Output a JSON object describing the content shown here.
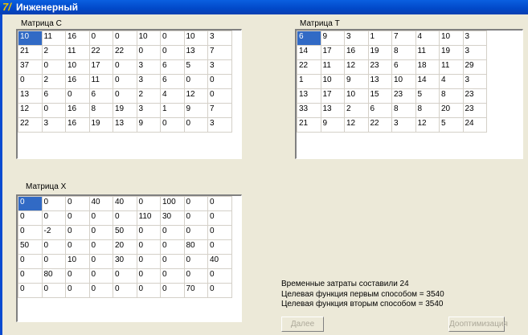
{
  "window": {
    "title": "Инженерный"
  },
  "matrix_c": {
    "label": "Матрица C",
    "rows": [
      [
        "10",
        "11",
        "16",
        "0",
        "0",
        "10",
        "0",
        "10",
        "3"
      ],
      [
        "21",
        "2",
        "11",
        "22",
        "22",
        "0",
        "0",
        "13",
        "7"
      ],
      [
        "37",
        "0",
        "10",
        "17",
        "0",
        "3",
        "6",
        "5",
        "3"
      ],
      [
        "0",
        "2",
        "16",
        "11",
        "0",
        "3",
        "6",
        "0",
        "0"
      ],
      [
        "13",
        "6",
        "0",
        "6",
        "0",
        "2",
        "4",
        "12",
        "0"
      ],
      [
        "12",
        "0",
        "16",
        "8",
        "19",
        "3",
        "1",
        "9",
        "7"
      ],
      [
        "22",
        "3",
        "16",
        "19",
        "13",
        "9",
        "0",
        "0",
        "3"
      ]
    ]
  },
  "matrix_t": {
    "label": "Матрица T",
    "rows": [
      [
        "6",
        "9",
        "3",
        "1",
        "7",
        "4",
        "10",
        "3"
      ],
      [
        "14",
        "17",
        "16",
        "19",
        "8",
        "11",
        "19",
        "3"
      ],
      [
        "22",
        "11",
        "12",
        "23",
        "6",
        "18",
        "11",
        "29"
      ],
      [
        "1",
        "10",
        "9",
        "13",
        "10",
        "14",
        "4",
        "3"
      ],
      [
        "13",
        "17",
        "10",
        "15",
        "23",
        "5",
        "8",
        "23"
      ],
      [
        "33",
        "13",
        "2",
        "6",
        "8",
        "8",
        "20",
        "23"
      ],
      [
        "21",
        "9",
        "12",
        "22",
        "3",
        "12",
        "5",
        "24"
      ]
    ]
  },
  "matrix_x": {
    "label": "Матрица X",
    "rows": [
      [
        "0",
        "0",
        "0",
        "40",
        "40",
        "0",
        "100",
        "0",
        "0"
      ],
      [
        "0",
        "0",
        "0",
        "0",
        "0",
        "110",
        "30",
        "0",
        "0"
      ],
      [
        "0",
        "-2",
        "0",
        "0",
        "50",
        "0",
        "0",
        "0",
        "0"
      ],
      [
        "50",
        "0",
        "0",
        "0",
        "20",
        "0",
        "0",
        "80",
        "0"
      ],
      [
        "0",
        "0",
        "10",
        "0",
        "30",
        "0",
        "0",
        "0",
        "40"
      ],
      [
        "0",
        "80",
        "0",
        "0",
        "0",
        "0",
        "0",
        "0",
        "0"
      ],
      [
        "0",
        "0",
        "0",
        "0",
        "0",
        "0",
        "0",
        "70",
        "0"
      ]
    ]
  },
  "results": {
    "time_cost": "Временные затраты составили 24",
    "objective_first": "Целевая функция первым способом = 3540",
    "objective_second": "Целевая функция вторым способом = 3540"
  },
  "buttons": {
    "next": "Далее",
    "reoptimize": "Дооптимизация"
  }
}
